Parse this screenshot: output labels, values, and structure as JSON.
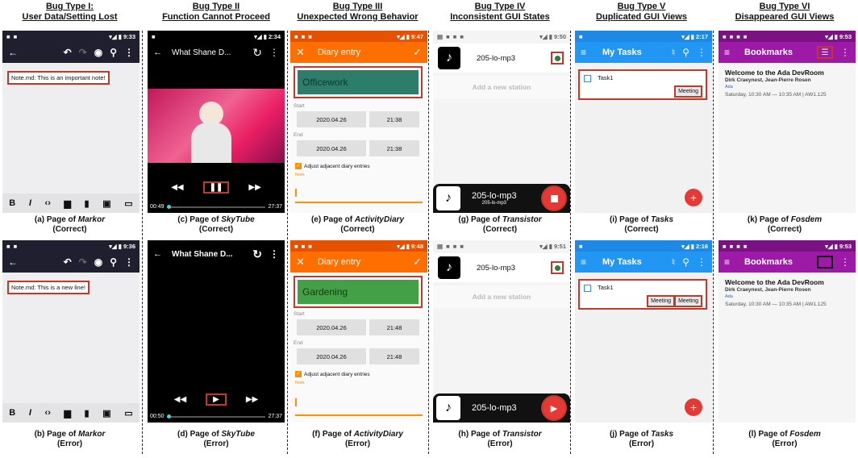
{
  "columns": [
    {
      "t1": "Bug Type I:",
      "t2": "User Data/Setting Lost",
      "top": {
        "time": "9:33",
        "note": "Note.md: This is an important note!",
        "c1": "(a) Page of",
        "app": "Markor",
        "c2": "(Correct)"
      },
      "bot": {
        "time": "9:36",
        "note": "Note.md: This is a new line!",
        "c1": "(b) Page of",
        "app": "Markor",
        "c2": "(Error)"
      }
    },
    {
      "t1": "Bug Type II",
      "t2": "Function Cannot Proceed",
      "top": {
        "time": "2:34",
        "title": "What Shane D...",
        "cur": "00:49",
        "dur": "27:37",
        "c1": "(c) Page of",
        "app": "SkyTube",
        "c2": "(Correct)"
      },
      "bot": {
        "title": "What Shane D...",
        "cur": "00:50",
        "dur": "27:37",
        "c1": "(d) Page of",
        "app": "SkyTube",
        "c2": "(Error)"
      }
    },
    {
      "t1": "Bug Type III",
      "t2": "Unexpected Wrong Behavior",
      "top": {
        "time": "9:47",
        "title": "Diary entry",
        "activity": "Officework",
        "start": "Start",
        "end": "End",
        "d1": "2020.04.26",
        "t1": "21:38",
        "d2": "2020.04.26",
        "t2": "21:38",
        "adj": "Adjust adjacent diary entries",
        "note": "Note",
        "c1": "(e) Page of",
        "app": "ActivityDiary",
        "c2": "(Correct)"
      },
      "bot": {
        "time": "9:48",
        "title": "Diary entry",
        "activity": "Gardening",
        "start": "Start",
        "end": "End",
        "d1": "2020.04.26",
        "t1": "21:48",
        "d2": "2020.04.26",
        "t2": "21:48",
        "adj": "Adjust adjacent diary entries",
        "note": "Note",
        "c1": "(f) Page of",
        "app": "ActivityDiary",
        "c2": "(Error)"
      }
    },
    {
      "t1": "Bug Type IV",
      "t2": "Inconsistent GUI States",
      "top": {
        "time": "9:50",
        "station": "205-lo-mp3",
        "add": "Add a new station",
        "player": "205-lo-mp3",
        "sub": "205-lo-mp3",
        "c1": "(g) Page of",
        "app": "Transistor",
        "c2": "(Correct)"
      },
      "bot": {
        "time": "9:51",
        "station": "205-lo-mp3",
        "add": "Add a new station",
        "player": "205-lo-mp3",
        "c1": "(h) Page of",
        "app": "Transistor",
        "c2": "(Error)"
      }
    },
    {
      "t1": "Bug Type V",
      "t2": "Duplicated GUI Views",
      "top": {
        "time": "2:17",
        "title": "My Tasks",
        "task": "Task1",
        "tag": "Meeting",
        "c1": "(i) Page of",
        "app": "Tasks",
        "c2": "(Correct)"
      },
      "bot": {
        "time": "2:16",
        "title": "My Tasks",
        "task": "Task1",
        "tag": "Meeting",
        "tag2": "Meeting",
        "c1": "(j) Page of",
        "app": "Tasks",
        "c2": "(Error)"
      }
    },
    {
      "t1": "Bug Type VI",
      "t2": "Disappeared GUI Views",
      "top": {
        "time": "9:53",
        "title": "Bookmarks",
        "h": "Welcome to the Ada DevRoom",
        "auth": "Dirk Craeynest, Jean-Pierre Rosen",
        "track": "Ada",
        "when": "Saturday, 10:30 AM — 10:35 AM | AW1.125",
        "c1": "(k) Page of",
        "app": "Fosdem",
        "c2": "(Correct)"
      },
      "bot": {
        "time": "9:53",
        "title": "Bookmarks",
        "h": "Welcome to the Ada DevRoom",
        "auth": "Dirk Craeynest, Jean-Pierre Rosen",
        "track": "Ada",
        "when": "Saturday, 10:30 AM — 10:35 AM | AW1.125",
        "c1": "(l) Page of",
        "app": "Fosdem",
        "c2": "(Error)"
      }
    }
  ],
  "colors": {
    "markor": "#1f1f30",
    "orange": "#ff6f00",
    "green": "#2e7d5b",
    "blue": "#2196f3",
    "purple": "#9c1aa5",
    "red": "#e53935",
    "highlight": "#c0392b"
  }
}
